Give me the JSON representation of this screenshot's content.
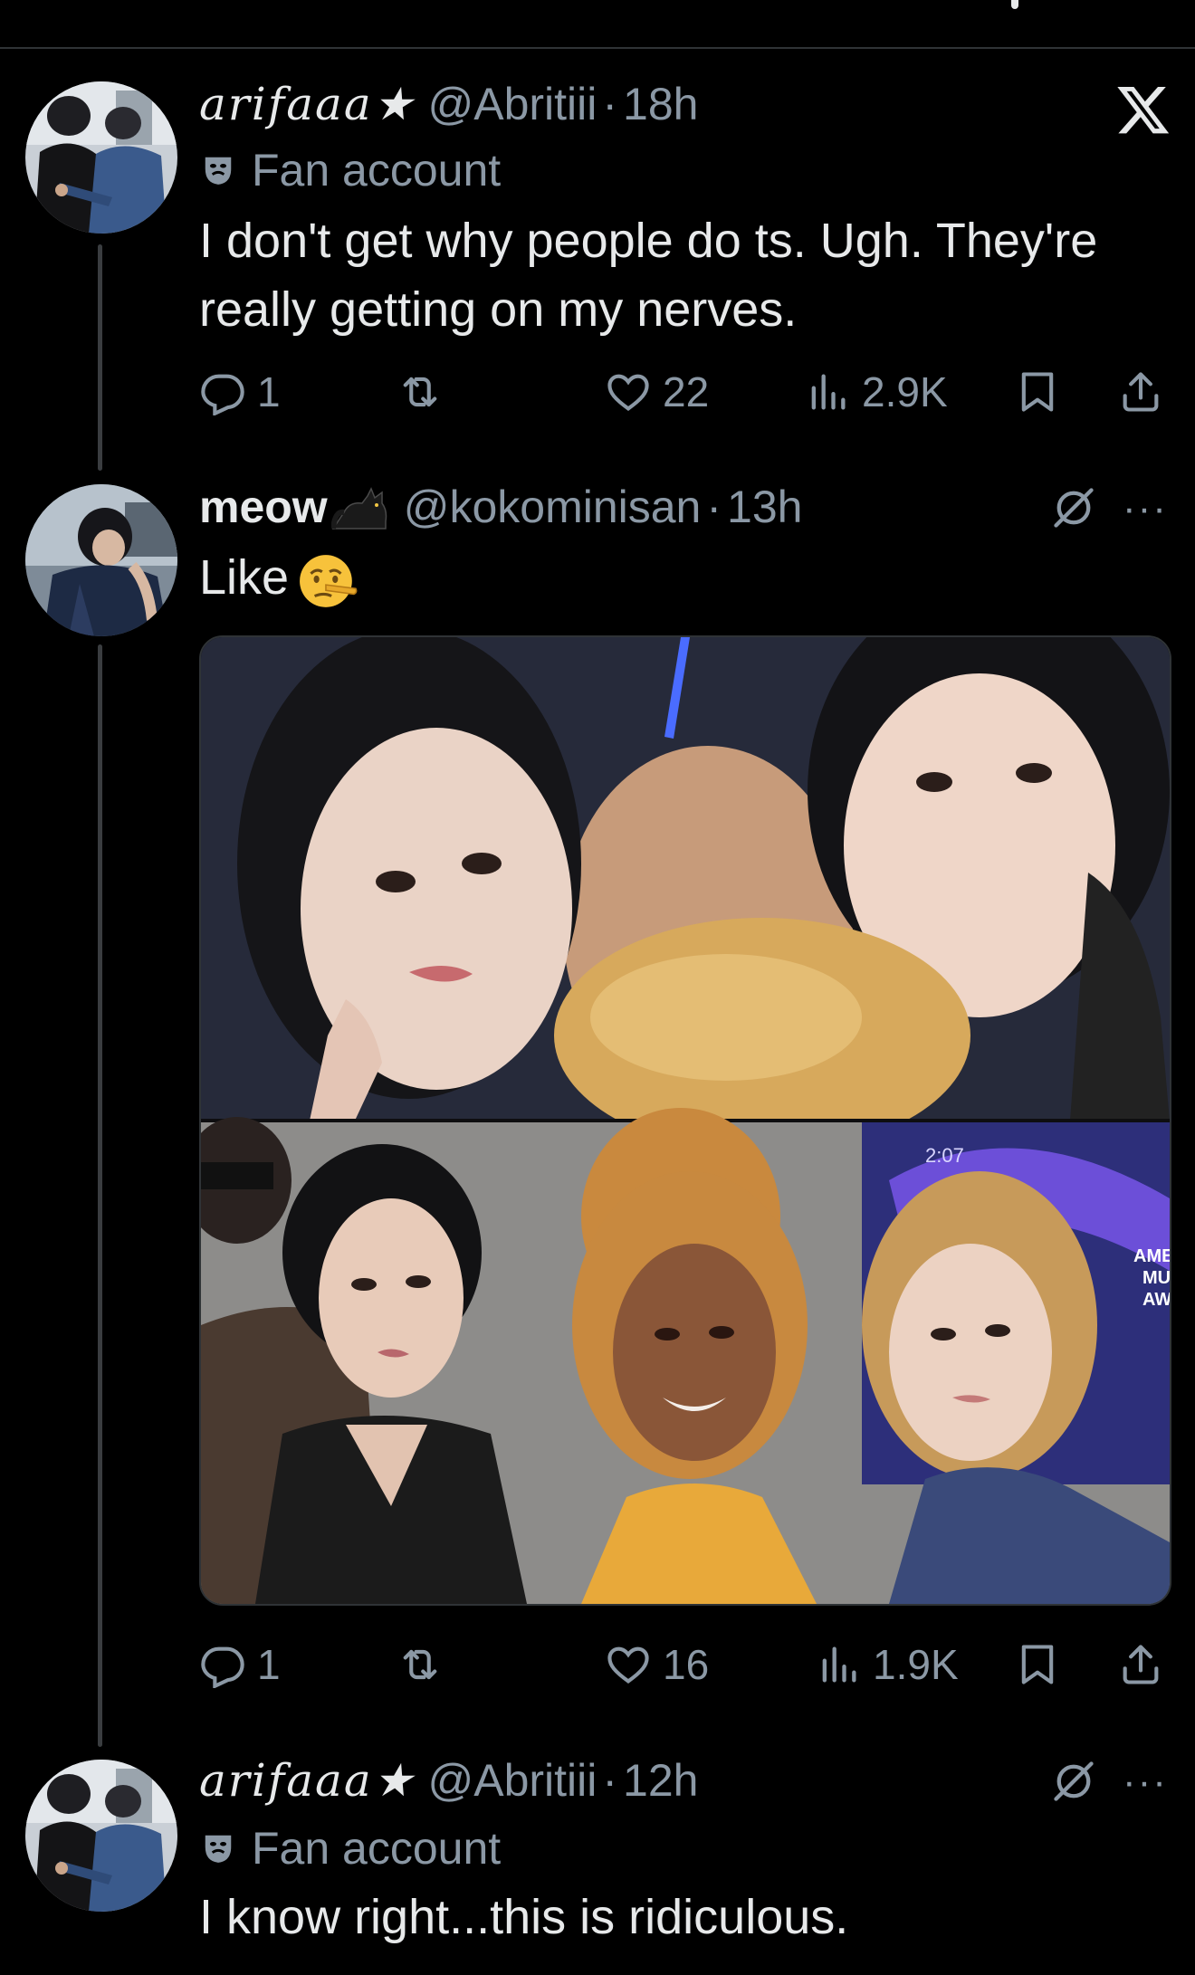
{
  "tweets": [
    {
      "name": "arifaaa★",
      "handle": "@Abritiii",
      "separator": "·",
      "time": "18h",
      "label": "Fan account",
      "text_line1": "I don't get why people do ts. Ugh. They're",
      "text_line2": "really getting on my nerves.",
      "replies": "1",
      "likes": "22",
      "views": "2.9K"
    },
    {
      "name": "meow",
      "name_emoji": "black-cat",
      "handle": "@kokominisan",
      "separator": "·",
      "time": "13h",
      "text": "Like",
      "text_emoji": "lying-face",
      "replies": "1",
      "likes": "16",
      "views": "1.9K",
      "media_text": [
        "2:07",
        "AME",
        "MU",
        "AW"
      ]
    },
    {
      "name": "arifaaa★",
      "handle": "@Abritiii",
      "separator": "·",
      "time": "12h",
      "label": "Fan account",
      "text": "I know right...this is ridiculous."
    }
  ],
  "more_label": "···",
  "icons": [
    "x-logo-icon",
    "reply-icon",
    "retweet-icon",
    "like-icon",
    "views-icon",
    "bookmark-icon",
    "share-icon",
    "muted-icon",
    "more-icon",
    "fan-mask-icon"
  ],
  "colors": {
    "background": "#000000",
    "text": "#e7e9ea",
    "secondary": "#8b98a5",
    "divider": "#2f3336"
  }
}
